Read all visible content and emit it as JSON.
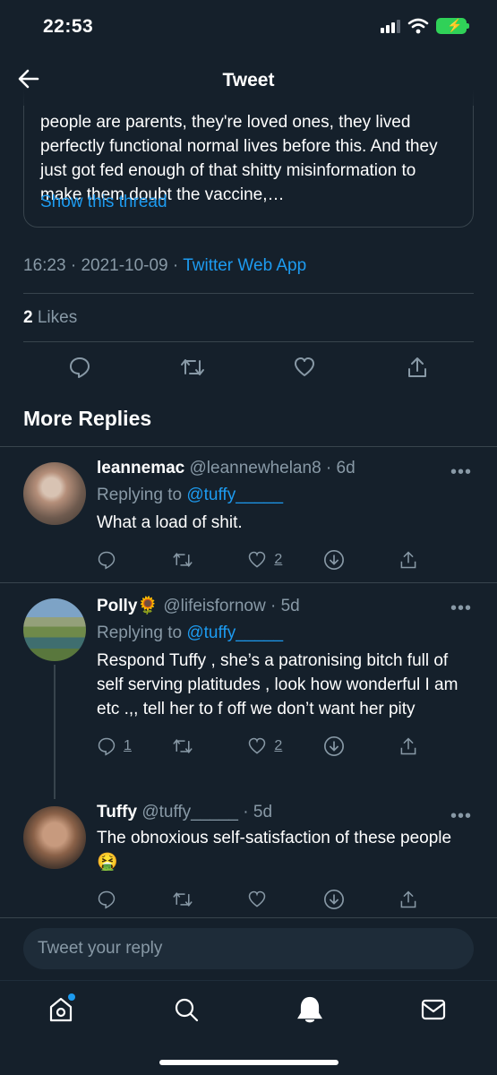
{
  "status_bar": {
    "time": "22:53"
  },
  "header": {
    "title": "Tweet"
  },
  "quoted_tweet": {
    "text_visible": "people are parents, they're loved ones, they lived perfectly functional normal lives before this. And they just got fed enough of that shitty misinformation to make them doubt the vaccine,…",
    "show_thread": "Show this thread"
  },
  "tweet_meta": {
    "time": "16:23",
    "date": "2021-10-09",
    "separator": "·",
    "source": "Twitter Web App"
  },
  "likes": {
    "count": "2",
    "label": "Likes"
  },
  "section_title": "More Replies",
  "replies": [
    {
      "name": "leannemac",
      "handle": "@leannewhelan8",
      "age": "· 6d",
      "replying_label": "Replying to",
      "replying_to": "@tuffy_____",
      "text": "What a load of shit.",
      "reply_count": "",
      "like_count": "2"
    },
    {
      "name": "Polly",
      "name_emoji": "🌻",
      "handle": "@lifeisfornow",
      "age": "· 5d",
      "replying_label": "Replying to",
      "replying_to": "@tuffy_____",
      "text": "Respond Tuffy , she’s a patronising bitch full of self serving platitudes , look how wonderful I am etc .,, tell her to f off we don’t want her pity",
      "reply_count": "1",
      "like_count": "2"
    },
    {
      "name": "Tuffy",
      "handle": "@tuffy_____",
      "age": "· 5d",
      "text": "The obnoxious self-satisfaction of these people",
      "text_emoji": "🤮",
      "reply_count": "",
      "like_count": ""
    }
  ],
  "composer": {
    "placeholder": "Tweet your reply"
  },
  "more_glyph": "•••",
  "icons": [
    "back-arrow-icon",
    "reply-icon",
    "retweet-icon",
    "like-icon",
    "share-icon",
    "download-icon",
    "home-icon",
    "search-icon",
    "notifications-icon",
    "messages-icon"
  ],
  "colors": {
    "background": "#15202b",
    "accent": "#1d9bf0",
    "muted": "#8899a6",
    "border": "#38444d"
  }
}
